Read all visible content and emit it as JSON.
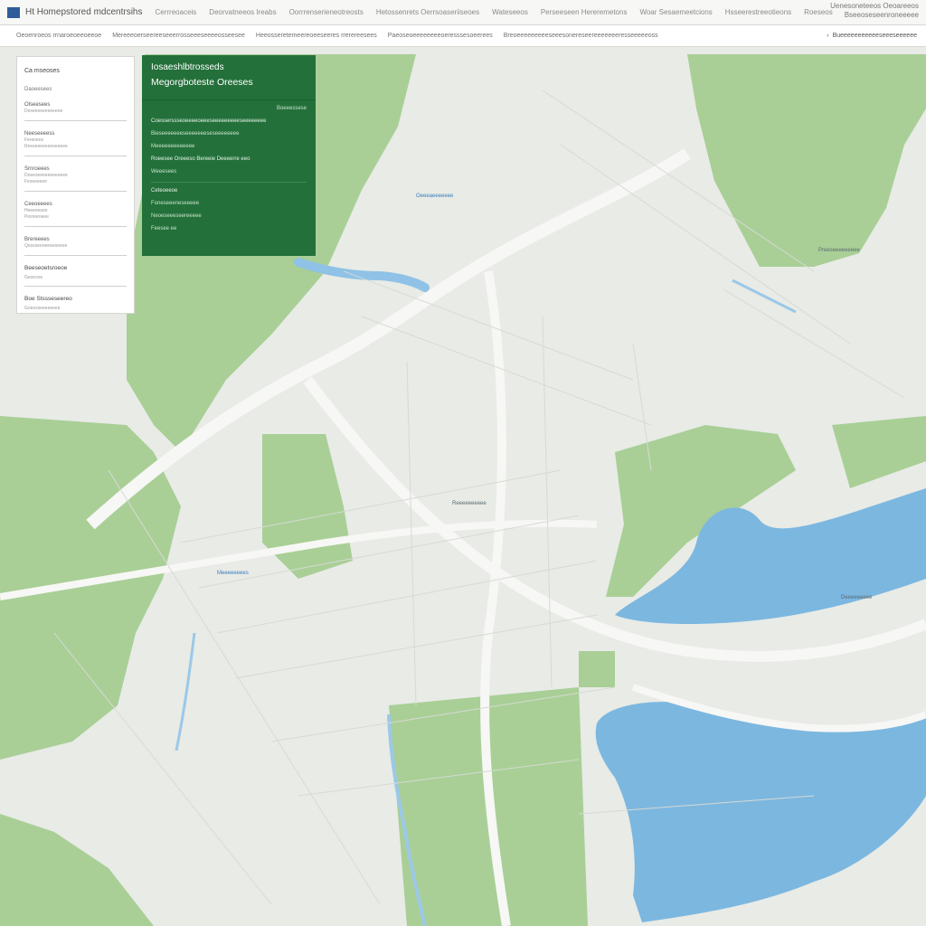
{
  "header": {
    "app_title": "Ht Homepstored mdcentrsihs",
    "nav": [
      "Cerrreoaceis",
      "Deorvatneeos Ireabs",
      "Oorrrenserieneotreosts",
      "Hetossenrets Oerrsoaseriiseoes",
      "Wateseeos",
      "Perseeseen Hereremetons",
      "Woar Sesaemeetcions",
      "Hsseerestreeotieons",
      "Roeseos"
    ],
    "right_line1": "Uenesoneteeos Oeoareeos",
    "right_line2": "Bseeoseseenroneeeee"
  },
  "subheader": {
    "nav": [
      "Oeoenroeos rrnaroeoeeoeeoe",
      "Mereeeoerseereeseeerrosseeeseeeeosseesee",
      "Heeosseretemeereoeeseeres rrerereesees",
      "Paeoseoeeeeeeeeoeresssesoeerees",
      "Breoeeeeeeeeeseeesonereseereeeeeeeresseeeeeoss"
    ],
    "right_label": "Bueeeeeeeeeeeseeeseeeeee"
  },
  "panel": {
    "heading": "Ca mseoses",
    "sub": "Daoeesees",
    "groups": [
      {
        "title": "Olseesees",
        "lines": [
          "Deseeeeeeeeeeee"
        ]
      },
      {
        "title": "Neeseeeess",
        "lines": [
          "Ferenees",
          "Reeseeeeeeeeeeeee"
        ]
      },
      {
        "title": "Srnroeees",
        "lines": [
          "Doeeseeeeeeeeeeee",
          "Feseeeeee"
        ]
      },
      {
        "title": "Ceeoeeees",
        "lines": [
          "Heeeeesee",
          "Pesreeoeee"
        ]
      },
      {
        "title": "Brereeees",
        "lines": [
          "Qessseeoeeeeseeee"
        ]
      }
    ],
    "heading2": "Beeseoetsroeoe",
    "heading2_sub": "Geseoos",
    "heading3": "Boe Stssseseereo",
    "heading3_sub": "Goeesseeeeeeee"
  },
  "card": {
    "title1": "Iosaeshlbtrosseds",
    "title2": "Megorgboteste Oreeses",
    "small_right": "Boeeessese",
    "lines": [
      "Coesserssseoeeeeoeeeseeeeeeeeeseeeeeeee",
      "Bieseeeeeeeseeeeeeeseseeeeeeee",
      "Meeeeeeeeeeeee",
      "Roeesee Oreeeso Bereeie Deeeerre eeo",
      "Weeesees",
      "Ceteoeeoe",
      "Foneseeeneseeeee",
      "Neoeseeeseereeeee",
      "Feesee ee"
    ]
  },
  "map_labels": [
    {
      "text": "Preeseeeeeeeee",
      "color": "#5a6a70"
    },
    {
      "text": "Oeeeaeeeeeee",
      "color": "#3b7cc0"
    },
    {
      "text": "Reeeeeeeeee",
      "color": "#5a6a70"
    },
    {
      "text": "Meeeeeeees",
      "color": "#3b7cc0"
    },
    {
      "text": "Deeeeeeeee",
      "color": "#5a6a70"
    }
  ],
  "colors": {
    "land": "#e8ebe6",
    "green_area": "#a9cf97",
    "water": "#7cb7e0",
    "card": "#23703a",
    "road": "#ffffff"
  }
}
